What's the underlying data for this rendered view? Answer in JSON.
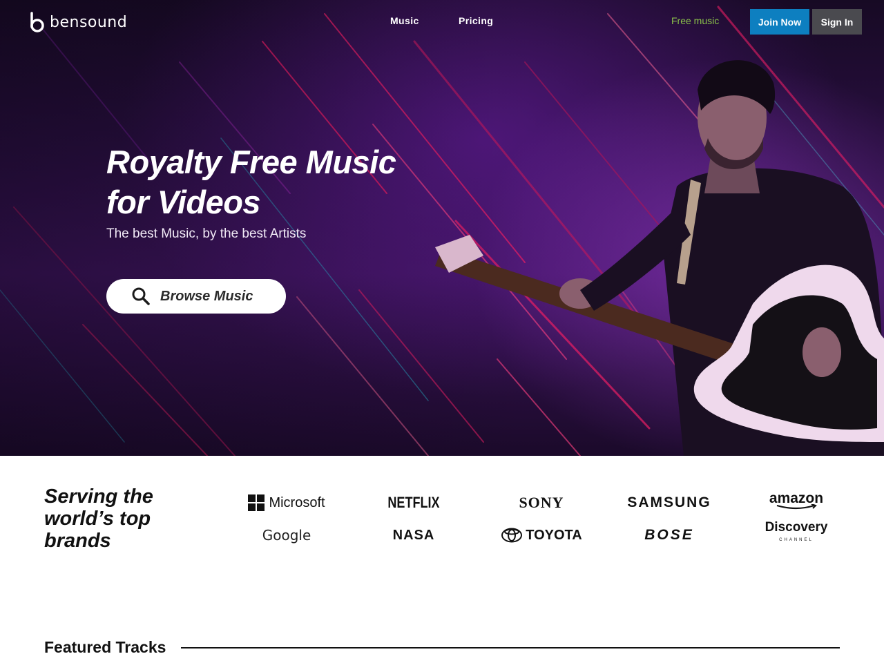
{
  "brand": {
    "name": "bensound"
  },
  "nav": {
    "links": [
      "Music",
      "Pricing"
    ],
    "free_music": "Free music",
    "join": "Join Now",
    "sign_in": "Sign In"
  },
  "hero": {
    "title_line1": "Royalty Free Music",
    "title_line2": "for Videos",
    "subtitle": "The best Music, by the best Artists",
    "browse_button": "Browse Music",
    "browse_icon": "search-icon"
  },
  "brands_section": {
    "title": "Serving the world’s top brands",
    "logos": [
      "Microsoft",
      "NETFLIX",
      "SONY",
      "SAMSUNG",
      "amazon",
      "Google",
      "NASA",
      "TOYOTA",
      "BOSE",
      "Discovery"
    ],
    "discovery_sub": "CHANNEL"
  },
  "featured": {
    "title": "Featured Tracks"
  },
  "colors": {
    "join_button": "#0d7fc0",
    "sign_in_button": "#4a4a4f",
    "free_music": "#8bc34a",
    "hero_bg": "#2a0f42"
  }
}
